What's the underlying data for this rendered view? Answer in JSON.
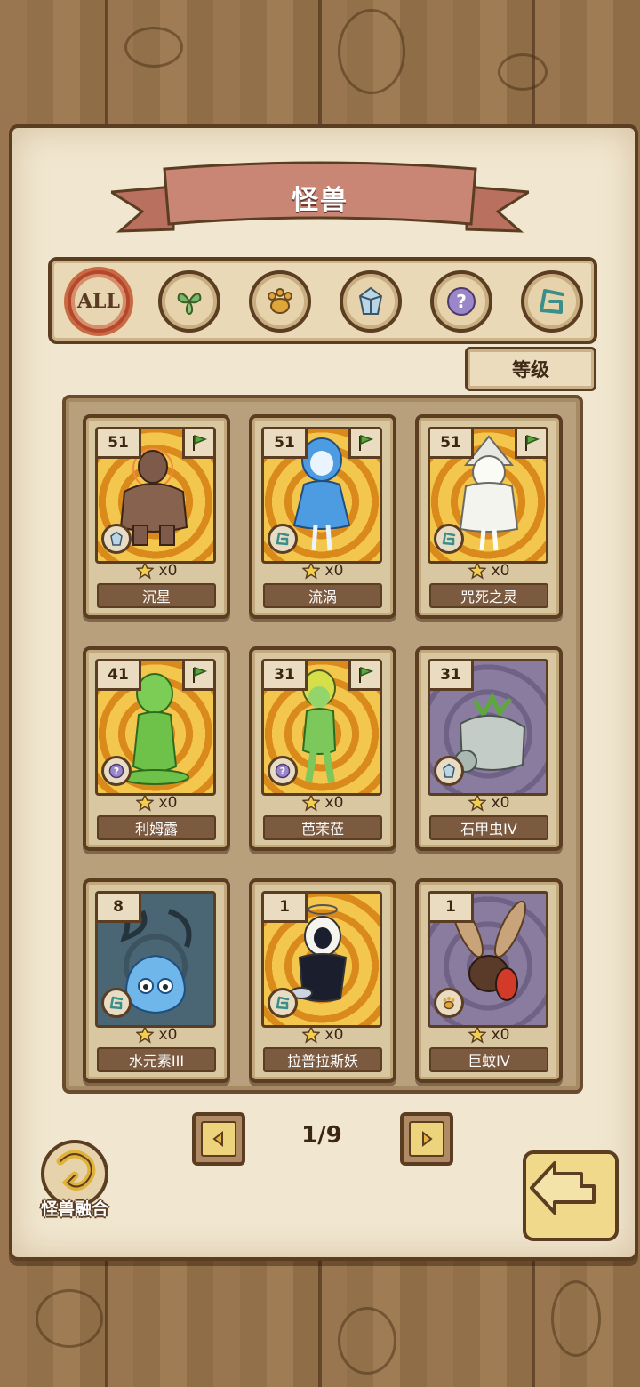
{
  "header": {
    "title": "怪兽"
  },
  "filters": [
    {
      "id": "all",
      "label": "ALL",
      "icon": "all-icon",
      "active": true
    },
    {
      "id": "plant",
      "icon": "leaf-icon"
    },
    {
      "id": "beast",
      "icon": "paw-icon"
    },
    {
      "id": "crystal",
      "icon": "crystal-icon"
    },
    {
      "id": "mystery",
      "icon": "question-icon"
    },
    {
      "id": "spiral",
      "icon": "spiral-icon"
    }
  ],
  "sort": {
    "label": "等级"
  },
  "cards": [
    {
      "name": "沉星",
      "level": "51",
      "stars": "x0",
      "flag": true,
      "element": "crystal",
      "bg": "gold"
    },
    {
      "name": "流涡",
      "level": "51",
      "stars": "x0",
      "flag": true,
      "element": "spiral",
      "bg": "gold"
    },
    {
      "name": "咒死之灵",
      "level": "51",
      "stars": "x0",
      "flag": true,
      "element": "spiral",
      "bg": "gold"
    },
    {
      "name": "利姆露",
      "level": "41",
      "stars": "x0",
      "flag": true,
      "element": "mystery",
      "bg": "gold"
    },
    {
      "name": "芭茉莅",
      "level": "31",
      "stars": "x0",
      "flag": true,
      "element": "mystery",
      "bg": "gold"
    },
    {
      "name": "石甲虫IV",
      "level": "31",
      "stars": "x0",
      "flag": false,
      "element": "crystal",
      "bg": "purple"
    },
    {
      "name": "水元素III",
      "level": "8",
      "stars": "x0",
      "flag": false,
      "element": "spiral",
      "bg": "slate"
    },
    {
      "name": "拉普拉斯妖",
      "level": "1",
      "stars": "x0",
      "flag": false,
      "element": "spiral",
      "bg": "gold"
    },
    {
      "name": "巨蚊IV",
      "level": "1",
      "stars": "x0",
      "flag": false,
      "element": "beast",
      "bg": "purple"
    }
  ],
  "pagination": {
    "text": "1/9",
    "prev_icon": "arrow-left-icon",
    "next_icon": "arrow-right-icon"
  },
  "fusion": {
    "label": "怪兽融合",
    "icon": "fusion-icon"
  },
  "back": {
    "icon": "back-arrow-icon"
  },
  "colors": {
    "paper": "#f1e7d0",
    "outline": "#5b3d22",
    "ribbon": "#c98674",
    "gold_bg": "#f3c64d",
    "purple_bg": "#8a7c9f"
  }
}
